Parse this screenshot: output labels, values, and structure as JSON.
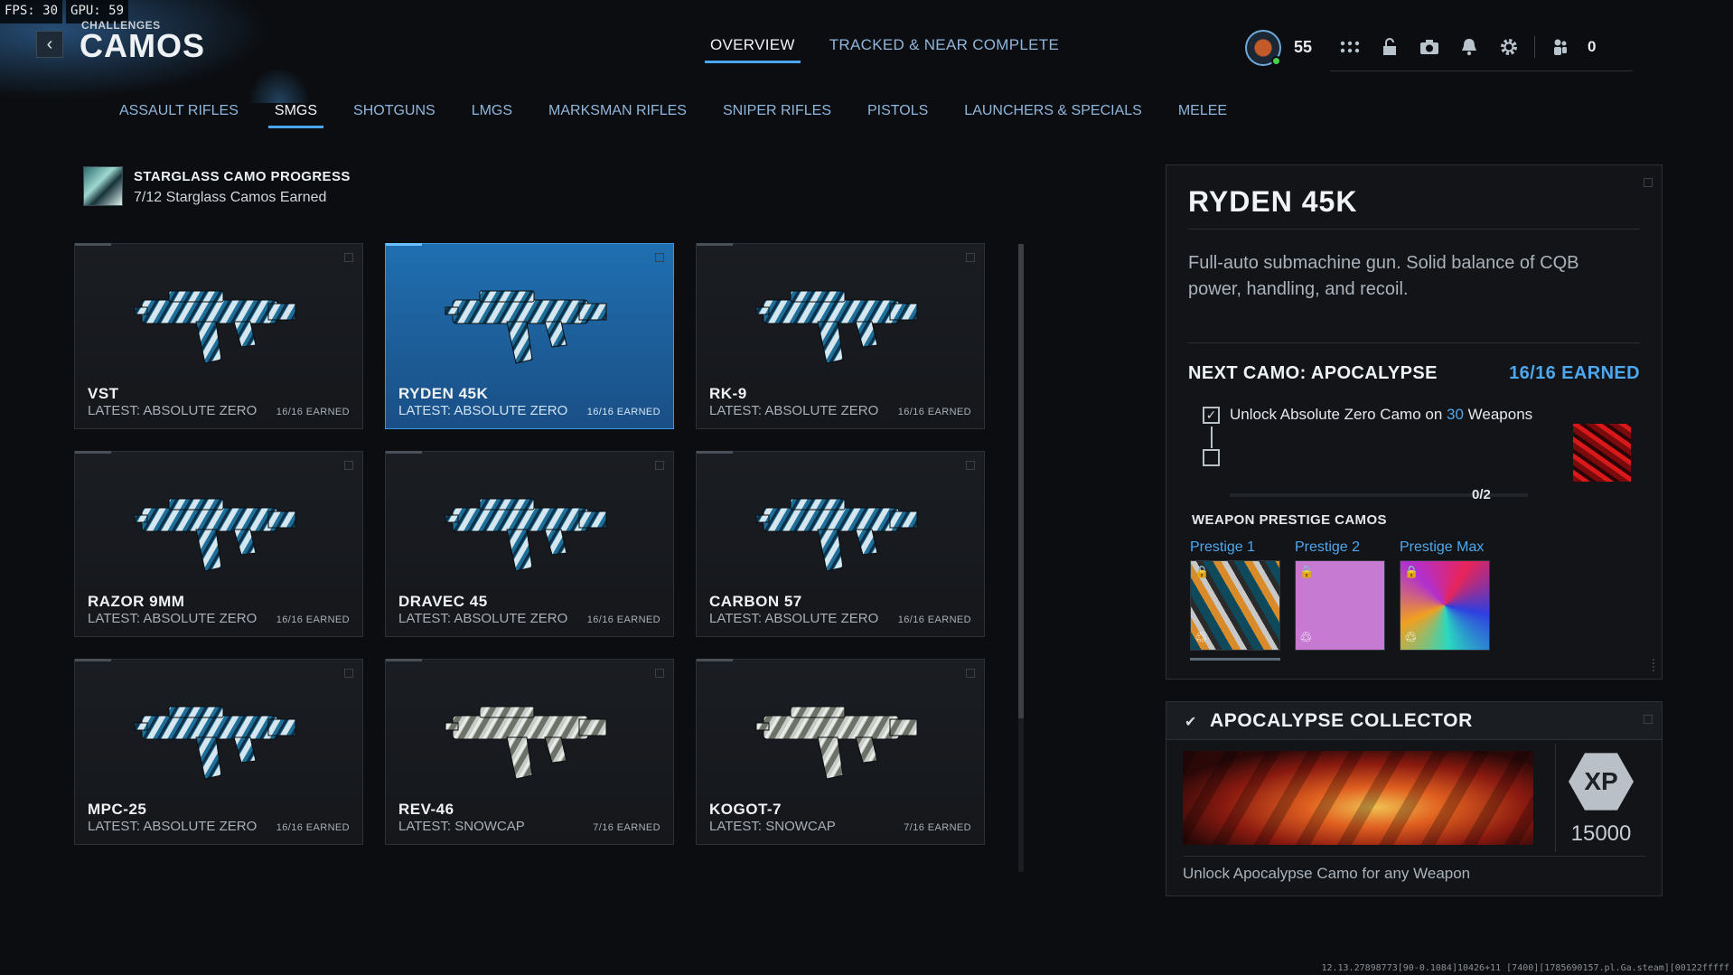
{
  "perf": {
    "fps_label": "FPS:",
    "fps": "30",
    "gpu_label": "GPU:",
    "gpu": "59"
  },
  "header": {
    "crumb": "CHALLENGES",
    "title": "CAMOS",
    "back_icon": "chevron-left-icon"
  },
  "top_tabs": [
    {
      "label": "OVERVIEW",
      "active": true
    },
    {
      "label": "TRACKED & NEAR COMPLETE",
      "active": false
    }
  ],
  "player": {
    "level": "55",
    "notification_count": "0"
  },
  "categories": [
    {
      "label": "ASSAULT RIFLES",
      "active": false
    },
    {
      "label": "SMGS",
      "active": true
    },
    {
      "label": "SHOTGUNS",
      "active": false
    },
    {
      "label": "LMGS",
      "active": false
    },
    {
      "label": "MARKSMAN RIFLES",
      "active": false
    },
    {
      "label": "SNIPER RIFLES",
      "active": false
    },
    {
      "label": "PISTOLS",
      "active": false
    },
    {
      "label": "LAUNCHERS & SPECIALS",
      "active": false
    },
    {
      "label": "MELEE",
      "active": false
    }
  ],
  "progress": {
    "title": "STARGLASS CAMO PROGRESS",
    "subtitle": "7/12 Starglass Camos Earned"
  },
  "weapons": [
    {
      "name": "VST",
      "latest": "LATEST: ABSOLUTE ZERO",
      "earned": "16/16 EARNED",
      "camo": "blue"
    },
    {
      "name": "RYDEN 45K",
      "latest": "LATEST: ABSOLUTE ZERO",
      "earned": "16/16 EARNED",
      "camo": "blue",
      "selected": true
    },
    {
      "name": "RK-9",
      "latest": "LATEST: ABSOLUTE ZERO",
      "earned": "16/16 EARNED",
      "camo": "blue"
    },
    {
      "name": "RAZOR 9MM",
      "latest": "LATEST: ABSOLUTE ZERO",
      "earned": "16/16 EARNED",
      "camo": "blue"
    },
    {
      "name": "DRAVEC 45",
      "latest": "LATEST: ABSOLUTE ZERO",
      "earned": "16/16 EARNED",
      "camo": "blue"
    },
    {
      "name": "CARBON 57",
      "latest": "LATEST: ABSOLUTE ZERO",
      "earned": "16/16 EARNED",
      "camo": "blue"
    },
    {
      "name": "MPC-25",
      "latest": "LATEST: ABSOLUTE ZERO",
      "earned": "16/16 EARNED",
      "camo": "blue"
    },
    {
      "name": "REV-46",
      "latest": "LATEST: SNOWCAP",
      "earned": "7/16 EARNED",
      "camo": "snow"
    },
    {
      "name": "KOGOT-7",
      "latest": "LATEST: SNOWCAP",
      "earned": "7/16 EARNED",
      "camo": "snow"
    }
  ],
  "detail": {
    "title": "RYDEN 45K",
    "description": "Full-auto submachine gun. Solid balance of CQB power, handling, and recoil.",
    "next_camo_label": "NEXT CAMO: APOCALYPSE",
    "next_camo_earned": "16/16 EARNED",
    "requirement_prefix": "Unlock Absolute Zero Camo on ",
    "requirement_number": "30",
    "requirement_suffix": " Weapons",
    "requirement_progress": "0/2",
    "prestige_title": "WEAPON PRESTIGE CAMOS",
    "prestige": [
      {
        "label": "Prestige 1"
      },
      {
        "label": "Prestige 2"
      },
      {
        "label": "Prestige Max"
      }
    ]
  },
  "collector": {
    "title": "APOCALYPSE COLLECTOR",
    "xp_label": "XP",
    "xp": "15000",
    "description": "Unlock Apocalypse Camo for any Weapon"
  },
  "build_string": "12.13.27898773[90-0.1084]10426+11 [7400][1785690157.pl.Ga.steam][00122fffff"
}
